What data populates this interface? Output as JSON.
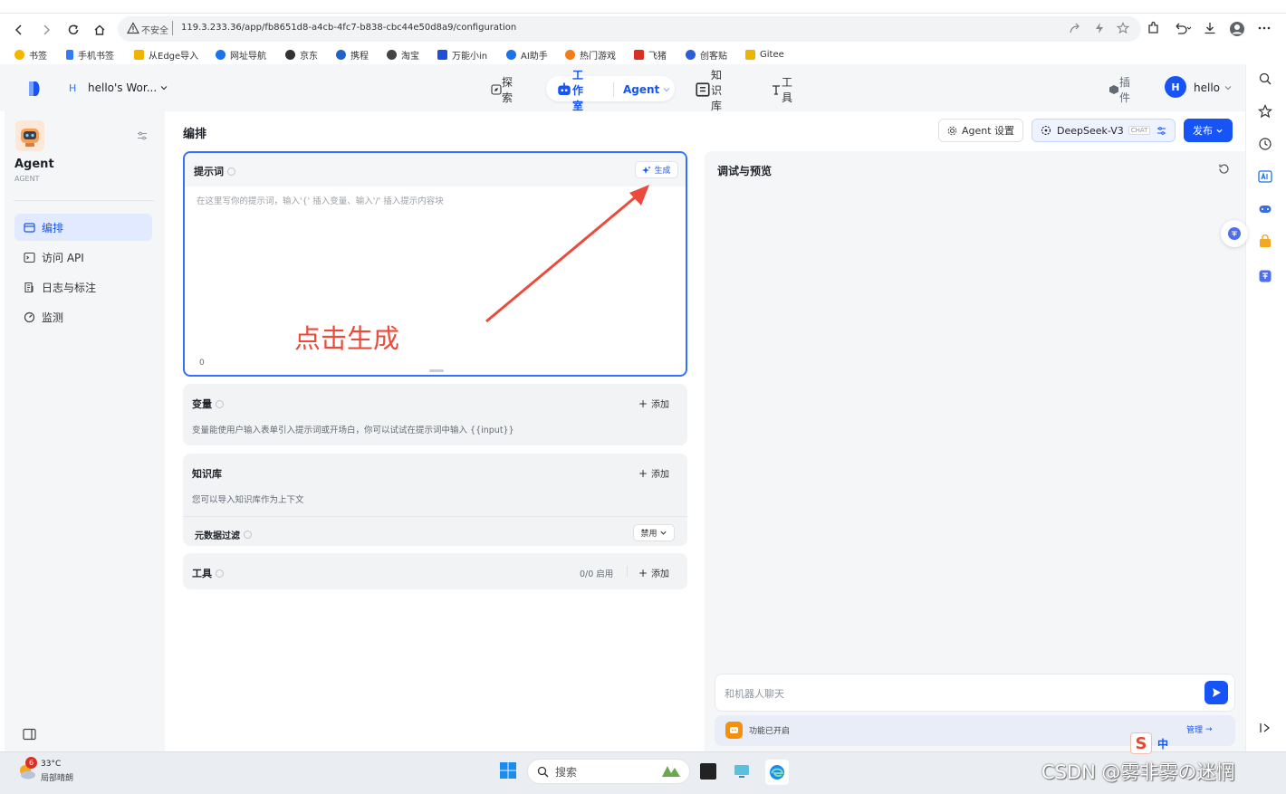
{
  "browser": {
    "insecure_label": "不安全",
    "url": "119.3.233.36/app/fb8651d8-a4cb-4fc7-b838-cbc44e50d8a9/configuration",
    "bookmarks": [
      "书签",
      "手机书签",
      "从Edge导入",
      "网址导航",
      "京东",
      "携程",
      "淘宝",
      "万能小in",
      "AI助手",
      "热门游戏",
      "飞猪",
      "创客贴",
      "Gitee"
    ],
    "bookmark_colors": [
      "#f5b400",
      "#2f7cf6",
      "#f0b400",
      "#1a73e8",
      "#333333",
      "#1e63c9",
      "#444444",
      "#1e4fd8",
      "#1a73e8",
      "#f07c1a",
      "#d93025",
      "#2b5cd9",
      "#f0b400"
    ]
  },
  "app": {
    "workspace_initial": "H",
    "workspace_name": "hello's Wor...",
    "nav": {
      "explore": "探索",
      "studio": "工作室",
      "agent": "Agent",
      "knowledge": "知识库",
      "tools": "工具"
    },
    "plugins": "插件",
    "user_initial": "H",
    "user_name": "hello"
  },
  "sidebar": {
    "agent_name": "Agent",
    "agent_type": "AGENT",
    "items": [
      {
        "label": "编排",
        "active": true
      },
      {
        "label": "访问 API",
        "active": false
      },
      {
        "label": "日志与标注",
        "active": false
      },
      {
        "label": "监测",
        "active": false
      }
    ]
  },
  "main": {
    "heading": "编排",
    "agent_settings": "Agent 设置",
    "model_name": "DeepSeek-V3",
    "model_tag": "CHAT",
    "publish": "发布",
    "prompt": {
      "title": "提示词",
      "generate": "生成",
      "placeholder": "在这里写你的提示词，输入'{' 插入变量、输入'/' 插入提示内容块",
      "char_count": "0"
    },
    "variables": {
      "title": "变量",
      "add": "添加",
      "desc": "变量能使用户输入表单引入提示词或开场白，你可以试试在提示词中输入 {{input}}"
    },
    "knowledge": {
      "title": "知识库",
      "add": "添加",
      "desc": "您可以导入知识库作为上下文",
      "metadata_filter": "元数据过滤",
      "filter_value": "禁用"
    },
    "tools": {
      "title": "工具",
      "count": "0/0 启用",
      "add": "添加"
    }
  },
  "preview": {
    "title": "调试与预览",
    "input_placeholder": "和机器人聊天",
    "features_label": "功能已开启",
    "manage": "管理"
  },
  "annotation": {
    "text": "点击生成",
    "color": "#ec4b3b"
  },
  "taskbar": {
    "weather_temp": "33°C",
    "weather_desc": "局部晴朗",
    "weather_badge": "6",
    "search": "搜索",
    "ime_label": "中"
  },
  "watermark": "CSDN @雾非雾の迷惘",
  "colors": {
    "accent": "#1654f5",
    "active_bg": "#e1eaff",
    "panel_bg": "#f5f6f8"
  }
}
